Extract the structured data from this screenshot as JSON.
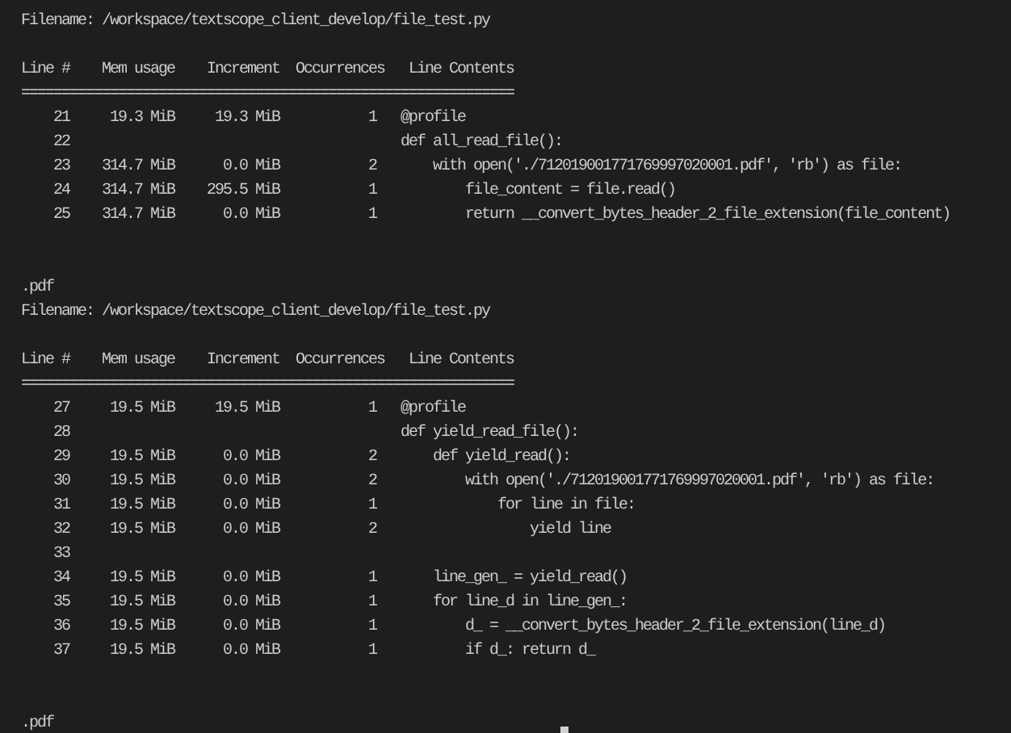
{
  "terminal": {
    "blocks": [
      {
        "filename": "Filename: /workspace/textscope_client_develop/file_test.py",
        "columns": [
          "Line #",
          "Mem usage",
          "Increment",
          "Occurrences",
          "Line Contents"
        ],
        "separator": "=============================================================",
        "rows": [
          {
            "line": "21",
            "mem_usage": "19.3 MiB",
            "increment": "19.3 MiB",
            "occurrences": "1",
            "contents": "@profile"
          },
          {
            "line": "22",
            "contents": "def all_read_file():"
          },
          {
            "line": "23",
            "mem_usage": "314.7 MiB",
            "increment": "0.0 MiB",
            "occurrences": "2",
            "contents": "    with open('./712019001771769997020001.pdf', 'rb') as file:"
          },
          {
            "line": "24",
            "mem_usage": "314.7 MiB",
            "increment": "295.5 MiB",
            "occurrences": "1",
            "contents": "        file_content = file.read()"
          },
          {
            "line": "25",
            "mem_usage": "314.7 MiB",
            "increment": "0.0 MiB",
            "occurrences": "1",
            "contents": "        return __convert_bytes_header_2_file_extension(file_content)"
          }
        ],
        "output": ".pdf"
      },
      {
        "filename": "Filename: /workspace/textscope_client_develop/file_test.py",
        "columns": [
          "Line #",
          "Mem usage",
          "Increment",
          "Occurrences",
          "Line Contents"
        ],
        "separator": "=============================================================",
        "rows": [
          {
            "line": "27",
            "mem_usage": "19.5 MiB",
            "increment": "19.5 MiB",
            "occurrences": "1",
            "contents": "@profile"
          },
          {
            "line": "28",
            "contents": "def yield_read_file():"
          },
          {
            "line": "29",
            "mem_usage": "19.5 MiB",
            "increment": "0.0 MiB",
            "occurrences": "2",
            "contents": "    def yield_read():"
          },
          {
            "line": "30",
            "mem_usage": "19.5 MiB",
            "increment": "0.0 MiB",
            "occurrences": "2",
            "contents": "        with open('./712019001771769997020001.pdf', 'rb') as file:"
          },
          {
            "line": "31",
            "mem_usage": "19.5 MiB",
            "increment": "0.0 MiB",
            "occurrences": "1",
            "contents": "            for line in file:"
          },
          {
            "line": "32",
            "mem_usage": "19.5 MiB",
            "increment": "0.0 MiB",
            "occurrences": "2",
            "contents": "                yield line"
          },
          {
            "line": "33"
          },
          {
            "line": "34",
            "mem_usage": "19.5 MiB",
            "increment": "0.0 MiB",
            "occurrences": "1",
            "contents": "    line_gen_ = yield_read()"
          },
          {
            "line": "35",
            "mem_usage": "19.5 MiB",
            "increment": "0.0 MiB",
            "occurrences": "1",
            "contents": "    for line_d in line_gen_:"
          },
          {
            "line": "36",
            "mem_usage": "19.5 MiB",
            "increment": "0.0 MiB",
            "occurrences": "1",
            "contents": "        d_ = __convert_bytes_header_2_file_extension(line_d)"
          },
          {
            "line": "37",
            "mem_usage": "19.5 MiB",
            "increment": "0.0 MiB",
            "occurrences": "1",
            "contents": "        if d_: return d_"
          }
        ],
        "output": ".pdf"
      }
    ]
  }
}
